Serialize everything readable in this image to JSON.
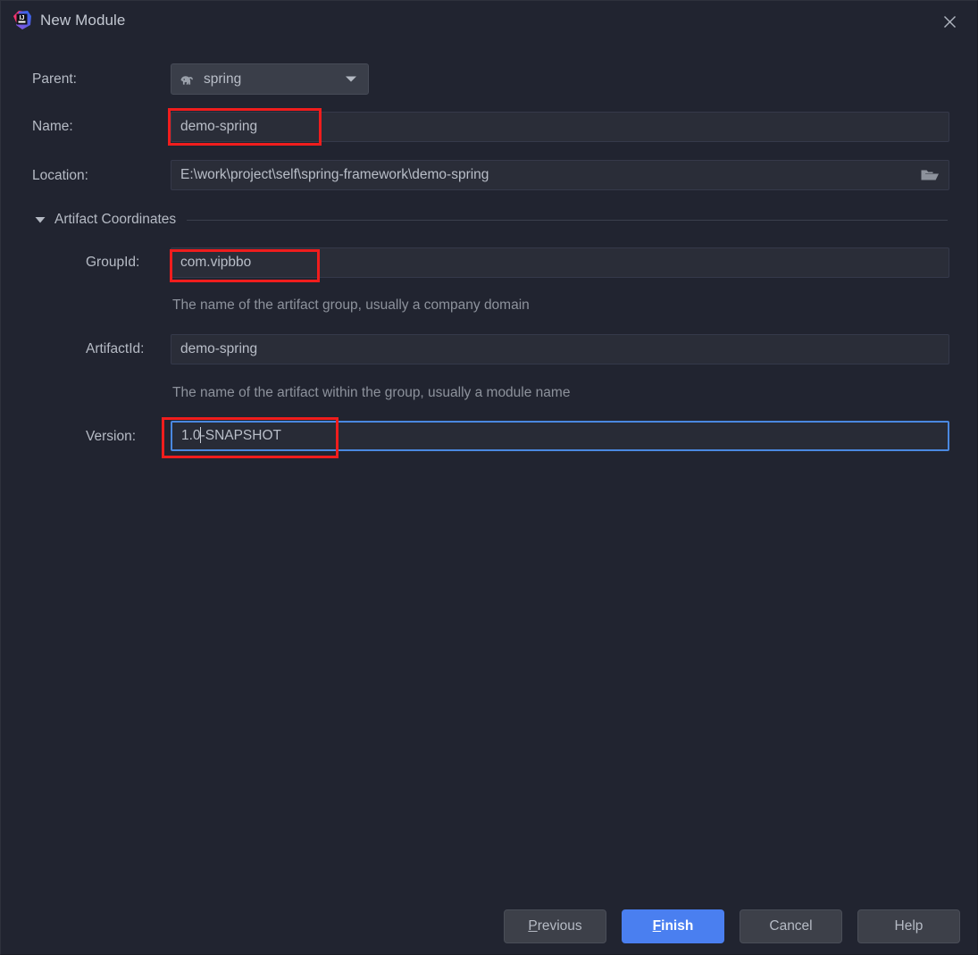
{
  "window": {
    "title": "New Module",
    "app_icon": "intellij-idea-logo",
    "close_icon": "close-icon"
  },
  "form": {
    "parent": {
      "label": "Parent:",
      "value": "spring",
      "icon": "maven-elephant-icon",
      "arrow_icon": "chevron-down-icon"
    },
    "name": {
      "label": "Name:",
      "value": "demo-spring",
      "highlighted": true
    },
    "location": {
      "label": "Location:",
      "value": "E:\\work\\project\\self\\spring-framework\\demo-spring",
      "browse_icon": "open-folder-icon"
    }
  },
  "artifact_section": {
    "title": "Artifact Coordinates",
    "expanded": true,
    "toggle_icon": "triangle-down-icon",
    "group_id": {
      "label": "GroupId:",
      "value": "com.vipbbo",
      "hint": "The name of the artifact group, usually a company domain",
      "highlighted": true
    },
    "artifact_id": {
      "label": "ArtifactId:",
      "value": "demo-spring",
      "hint": "The name of the artifact within the group, usually a module name"
    },
    "version": {
      "label": "Version:",
      "value_before_caret": "1.0",
      "value_after_caret": "-SNAPSHOT",
      "value": "1.0-SNAPSHOT",
      "focused": true,
      "highlighted": true
    }
  },
  "buttons": {
    "previous": {
      "label": "Previous",
      "mnemonic": "P",
      "rest": "revious"
    },
    "finish": {
      "label": "Finish",
      "mnemonic": "F",
      "rest": "inish",
      "primary": true
    },
    "cancel": {
      "label": "Cancel"
    },
    "help": {
      "label": "Help"
    }
  },
  "colors": {
    "background": "#212430",
    "field_background": "#2a2d38",
    "focus_border": "#4a88e0",
    "primary_button": "#4a7ff0",
    "annotation": "#f01d1d",
    "text": "#b6bbc5",
    "hint_text": "#8d929c"
  }
}
